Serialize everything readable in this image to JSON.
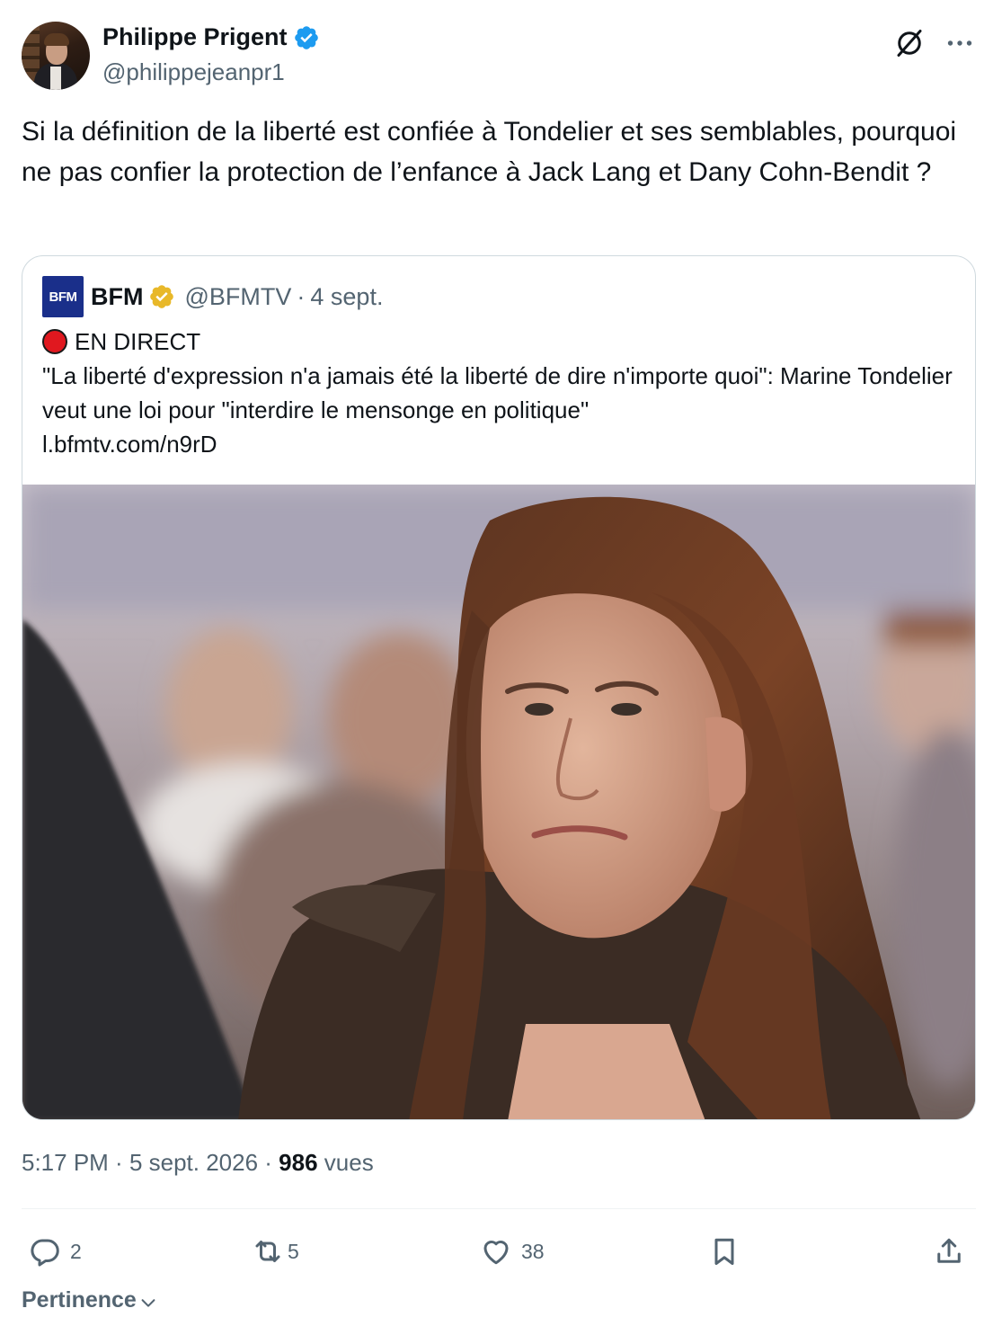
{
  "author": {
    "name": "Philippe Prigent",
    "handle": "@philippejeanpr1"
  },
  "tweet": {
    "text": "Si la définition de la liberté est confiée à Tondelier et ses semblables, pourquoi ne pas confier la protection de l’enfance à Jack Lang et Dany Cohn-Bendit ?"
  },
  "quote": {
    "logo_text": "BFM",
    "name": "BFM",
    "handle": "@BFMTV",
    "separator": "·",
    "date": "4 sept.",
    "live_label": "EN DIRECT",
    "text": "\"La liberté d'expression n'a jamais été la liberté de dire n'importe quoi\": Marine Tondelier veut une loi pour \"interdire le mensonge en politique\"",
    "link": "l.bfmtv.com/n9rD"
  },
  "meta": {
    "time": "5:17 PM",
    "sep1": " · ",
    "date": "5 sept. 2026",
    "sep2": " · ",
    "views_count": "986",
    "views_label": " vues"
  },
  "actions": {
    "replies": "2",
    "reposts": "5",
    "likes": "38"
  },
  "sort": {
    "label": "Pertinence"
  },
  "colors": {
    "verified_blue": "#1d9bf0",
    "gold_badge": "#e8b829",
    "live_red": "#e0181f",
    "bfm_blue": "#1a2f8a",
    "secondary_text": "#536471"
  },
  "icons": {
    "verified": "verified-badge-icon",
    "grok": "grok-icon",
    "more": "more-icon",
    "reply": "reply-icon",
    "repost": "repost-icon",
    "like": "heart-icon",
    "bookmark": "bookmark-icon",
    "share": "share-icon",
    "chevron": "chevron-down-icon"
  }
}
